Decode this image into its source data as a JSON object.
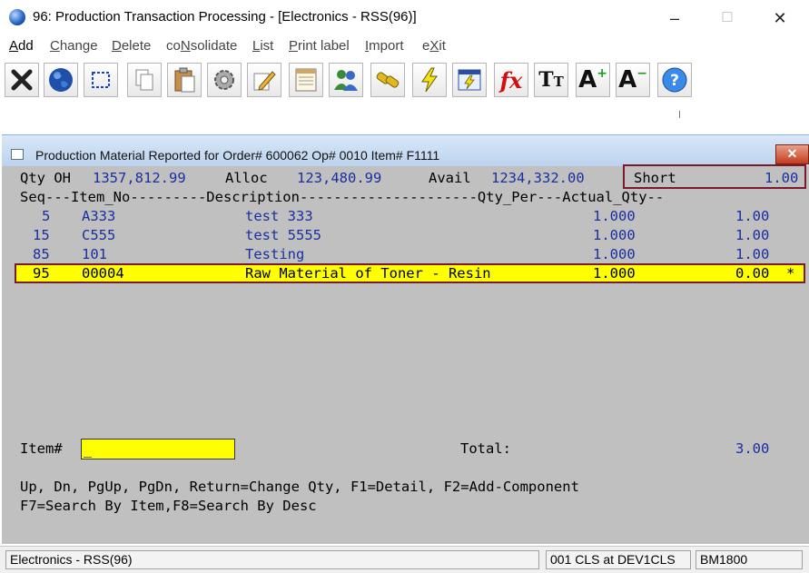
{
  "window": {
    "title": "96: Production Transaction Processing - [Electronics - RSS(96)]",
    "minimize": "–",
    "maximize": "☐",
    "close": "✕"
  },
  "menu": [
    {
      "label": "Add",
      "key": "A"
    },
    {
      "label": "Change",
      "key": "C"
    },
    {
      "label": "Delete",
      "key": "D"
    },
    {
      "label": "coNsolidate",
      "key": "N"
    },
    {
      "label": "List",
      "key": "L"
    },
    {
      "label": "Print label",
      "key": "P"
    },
    {
      "label": "Import",
      "key": "I"
    },
    {
      "label": "eXit",
      "key": "X"
    }
  ],
  "toolbar": {
    "icons": [
      "close-x-icon",
      "globe-icon",
      "select-rectangle-icon",
      "copy-icon",
      "paste-icon",
      "settings-gear-icon",
      "edit-pencil-icon",
      "notepad-icon",
      "users-icon",
      "link-chain-icon",
      "lightning-icon",
      "calculator-window-icon",
      "function-fx-icon",
      "text-size-icon",
      "font-grow-icon",
      "font-shrink-icon",
      "help-icon"
    ]
  },
  "child_window": {
    "title": "Production Material Reported for Order# 600062 Op# 0010 Item# F1111",
    "close": "✕"
  },
  "summary": {
    "qty_oh_label": "Qty OH",
    "qty_oh_value": "1357,812.99",
    "alloc_label": "Alloc",
    "alloc_value": "123,480.99",
    "avail_label": "Avail",
    "avail_value": "1234,332.00",
    "short_label": "Short",
    "short_value": "1.00"
  },
  "table": {
    "header": "Seq---Item_No---------Description---------------------Qty_Per---Actual_Qty--",
    "rows": [
      {
        "seq": "5",
        "item": "A333",
        "desc": "test 333",
        "qty_per": "1.000",
        "actual": "1.00",
        "flag": ""
      },
      {
        "seq": "15",
        "item": "C555",
        "desc": "test 5555",
        "qty_per": "1.000",
        "actual": "1.00",
        "flag": ""
      },
      {
        "seq": "85",
        "item": "101",
        "desc": "Testing",
        "qty_per": "1.000",
        "actual": "1.00",
        "flag": ""
      },
      {
        "seq": "95",
        "item": "00004",
        "desc": "Raw Material of Toner - Resin",
        "qty_per": "1.000",
        "actual": "0.00",
        "flag": "*"
      }
    ]
  },
  "item_field": {
    "label": "Item#",
    "value": "_"
  },
  "total": {
    "label": "Total:",
    "value": "3.00"
  },
  "help": {
    "line1": "Up, Dn, PgUp, PgDn, Return=Change Qty, F1=Detail, F2=Add-Component",
    "line2": "F7=Search By Item,F8=Search By Desc"
  },
  "status": {
    "company": "Electronics - RSS(96)",
    "session": "001 CLS at DEV1CLS",
    "program": "BM1800"
  },
  "colors": {
    "highlight": "#ffff00",
    "value_text": "#1a2fa0",
    "terminal_bg": "#c0c0c0",
    "outline": "#7a1a2a"
  }
}
